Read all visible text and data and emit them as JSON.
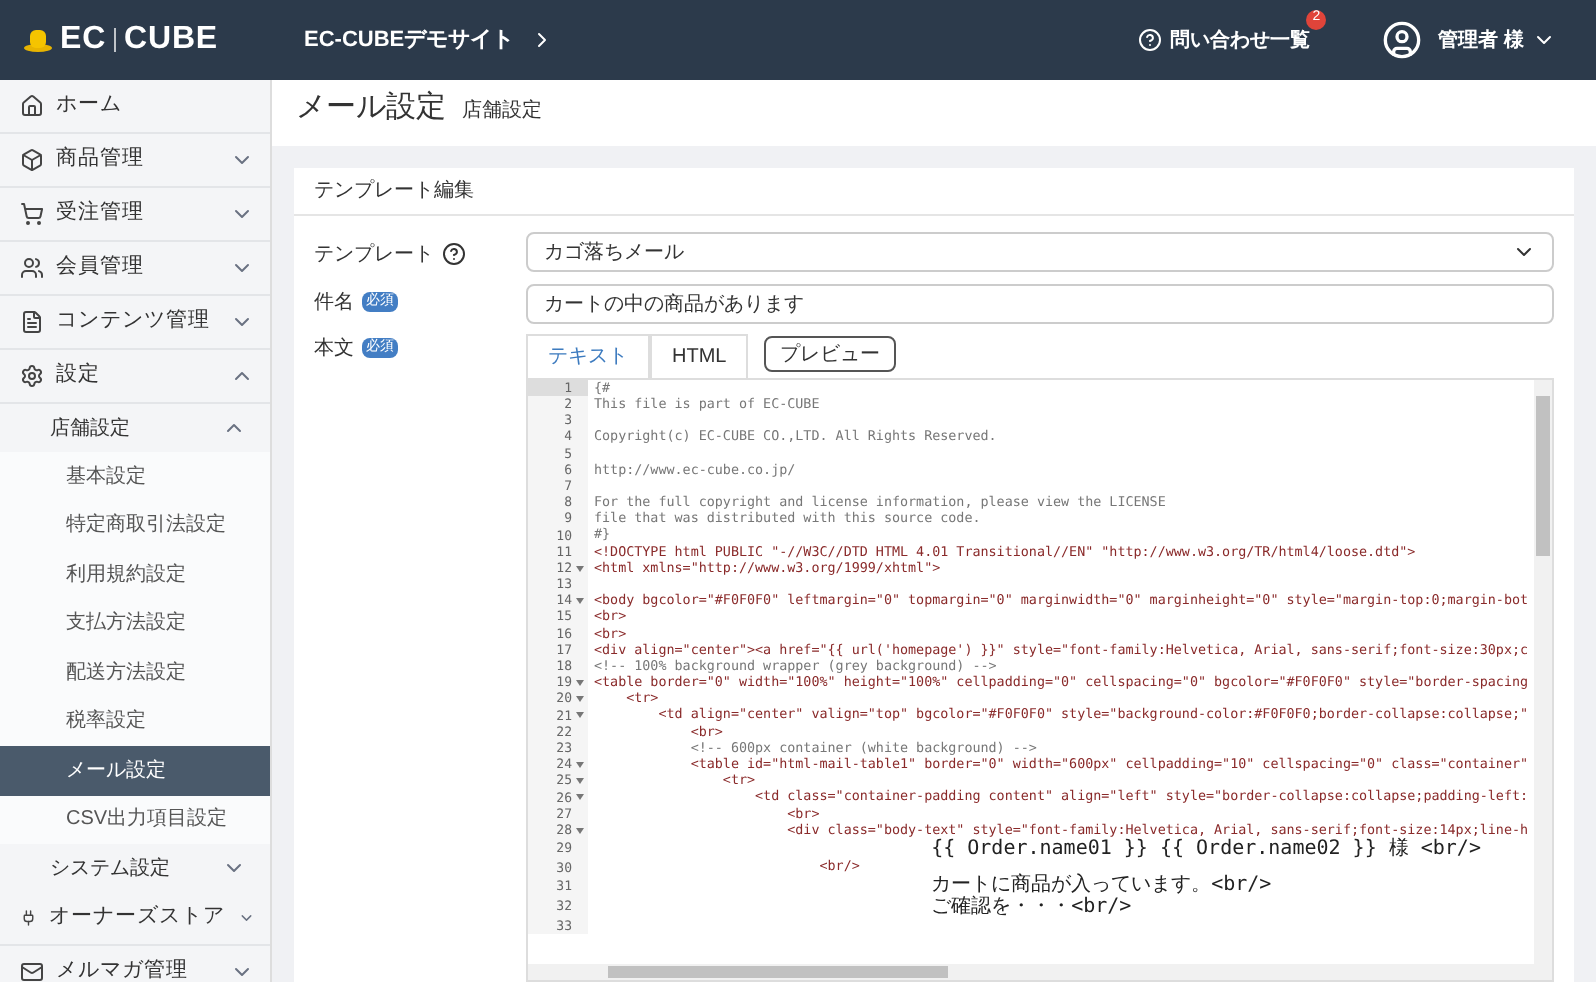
{
  "header": {
    "logo": [
      "EC",
      "CUBE"
    ],
    "site_name": "EC-CUBEデモサイト",
    "inquiries": {
      "label": "問い合わせ一覧",
      "badge": "2"
    },
    "user": "管理者 様"
  },
  "sidebar": {
    "items": [
      {
        "label": "ホーム"
      },
      {
        "label": "商品管理",
        "expanded": false
      },
      {
        "label": "受注管理",
        "expanded": false
      },
      {
        "label": "会員管理",
        "expanded": false
      },
      {
        "label": "コンテンツ管理",
        "expanded": false
      },
      {
        "label": "設定",
        "expanded": true,
        "children": [
          {
            "label": "店舗設定",
            "expanded": true,
            "children": [
              {
                "label": "基本設定",
                "selected": false
              },
              {
                "label": "特定商取引法設定",
                "selected": false
              },
              {
                "label": "利用規約設定",
                "selected": false
              },
              {
                "label": "支払方法設定",
                "selected": false
              },
              {
                "label": "配送方法設定",
                "selected": false
              },
              {
                "label": "税率設定",
                "selected": false
              },
              {
                "label": "メール設定",
                "selected": true
              },
              {
                "label": "CSV出力項目設定",
                "selected": false
              }
            ]
          },
          {
            "label": "システム設定",
            "expanded": false
          }
        ]
      },
      {
        "label": "オーナーズストア",
        "expanded": false
      },
      {
        "label": "メルマガ管理",
        "expanded": false
      }
    ]
  },
  "page": {
    "title": "メール設定",
    "subtitle": "店舗設定"
  },
  "card": {
    "title": "テンプレート編集",
    "template": {
      "label": "テンプレート",
      "value": "カゴ落ちメール"
    },
    "subject": {
      "label": "件名",
      "badge": "必須",
      "value": "カートの中の商品があります"
    },
    "body": {
      "label": "本文",
      "badge": "必須",
      "tabs": [
        {
          "label": "テキスト",
          "selected": true
        },
        {
          "label": "HTML",
          "selected": false
        }
      ],
      "preview": "プレビュー"
    },
    "code_lines": [
      {
        "number": "1",
        "kind": "comment",
        "text": "{#",
        "foldable": false
      },
      {
        "number": "2",
        "kind": "comment",
        "text": "This file is part of EC-CUBE",
        "foldable": false
      },
      {
        "number": "3",
        "kind": "comment",
        "foldable": false
      },
      {
        "number": "4",
        "kind": "comment",
        "text": "Copyright(c) EC-CUBE CO.,LTD. All Rights Reserved.",
        "foldable": false
      },
      {
        "number": "5",
        "kind": "comment",
        "foldable": false
      },
      {
        "number": "6",
        "kind": "comment",
        "text": "http://www.ec-cube.co.jp/",
        "foldable": false
      },
      {
        "number": "7",
        "kind": "comment",
        "foldable": false
      },
      {
        "number": "8",
        "kind": "comment",
        "text": "For the full copyright and license information, please view the LICENSE",
        "foldable": false
      },
      {
        "number": "9",
        "kind": "comment",
        "text": "file that was distributed with this source code.",
        "foldable": false
      },
      {
        "number": "10",
        "kind": "comment",
        "text": "#}",
        "foldable": false
      },
      {
        "number": "11",
        "kind": "tag",
        "text": "<!DOCTYPE html PUBLIC \"-//W3C//DTD HTML 4.01 Transitional//EN\" \"http://www.w3.org/TR/html4/loose.dtd\">",
        "foldable": false
      },
      {
        "number": "12",
        "kind": "tag",
        "text": "<html xmlns=\"http://www.w3.org/1999/xhtml\">",
        "foldable": true
      },
      {
        "number": "13",
        "kind": "tag",
        "foldable": false
      },
      {
        "number": "14",
        "kind": "tag",
        "text": "<body bgcolor=\"#F0F0F0\" leftmargin=\"0\" topmargin=\"0\" marginwidth=\"0\" marginheight=\"0\" style=\"margin-top:0;margin-bot",
        "foldable": true
      },
      {
        "number": "15",
        "kind": "tag",
        "text": "<br>",
        "foldable": false
      },
      {
        "number": "16",
        "kind": "tag",
        "text": "<br>",
        "foldable": false
      },
      {
        "number": "17",
        "kind": "tag",
        "text": "<div align=\"center\"><a href=\"{{ url('homepage') }}\" style=\"font-family:Helvetica, Arial, sans-serif;font-size:30px;c",
        "foldable": false
      },
      {
        "number": "18",
        "kind": "comment",
        "text": "<!-- 100% background wrapper (grey background) -->",
        "foldable": false
      },
      {
        "number": "19",
        "kind": "tag",
        "text": "<table border=\"0\" width=\"100%\" height=\"100%\" cellpadding=\"0\" cellspacing=\"0\" bgcolor=\"#F0F0F0\" style=\"border-spacing",
        "foldable": true
      },
      {
        "number": "20",
        "kind": "tag",
        "text": "    <tr>",
        "foldable": true
      },
      {
        "number": "21",
        "kind": "tag",
        "text": "        <td align=\"center\" valign=\"top\" bgcolor=\"#F0F0F0\" style=\"background-color:#F0F0F0;border-collapse:collapse;\"",
        "foldable": true
      },
      {
        "number": "22",
        "kind": "tag",
        "text": "            <br>",
        "foldable": false
      },
      {
        "number": "23",
        "kind": "comment",
        "text": "            <!-- 600px container (white background) -->",
        "foldable": false
      },
      {
        "number": "24",
        "kind": "tag",
        "text": "            <table id=\"html-mail-table1\" border=\"0\" width=\"600px\" cellpadding=\"10\" cellspacing=\"0\" class=\"container\"",
        "foldable": true
      },
      {
        "number": "25",
        "kind": "tag",
        "text": "                <tr>",
        "foldable": true
      },
      {
        "number": "26",
        "kind": "tag",
        "text": "                    <td class=\"container-padding content\" align=\"left\" style=\"border-collapse:collapse;padding-left:",
        "foldable": true
      },
      {
        "number": "27",
        "kind": "tag",
        "text": "                        <br>",
        "foldable": false
      },
      {
        "number": "28",
        "kind": "tag",
        "text": "                        <div class=\"body-text\" style=\"font-family:Helvetica, Arial, sans-serif;font-size:14px;line-h",
        "foldable": true
      },
      {
        "number": "29",
        "kind": "jp",
        "text": "                            {{ Order.name01 }} {{ Order.name02 }} 様 <br/>",
        "foldable": false
      },
      {
        "number": "30",
        "kind": "tag",
        "text": "                            <br/>",
        "foldable": false
      },
      {
        "number": "31",
        "kind": "jp",
        "text": "                            カートに商品が入っています。<br/>",
        "foldable": false
      },
      {
        "number": "32",
        "kind": "jp",
        "text": "                            ご確認を・・・<br/>",
        "foldable": false
      },
      {
        "number": "33",
        "kind": "tag",
        "foldable": false
      }
    ]
  }
}
